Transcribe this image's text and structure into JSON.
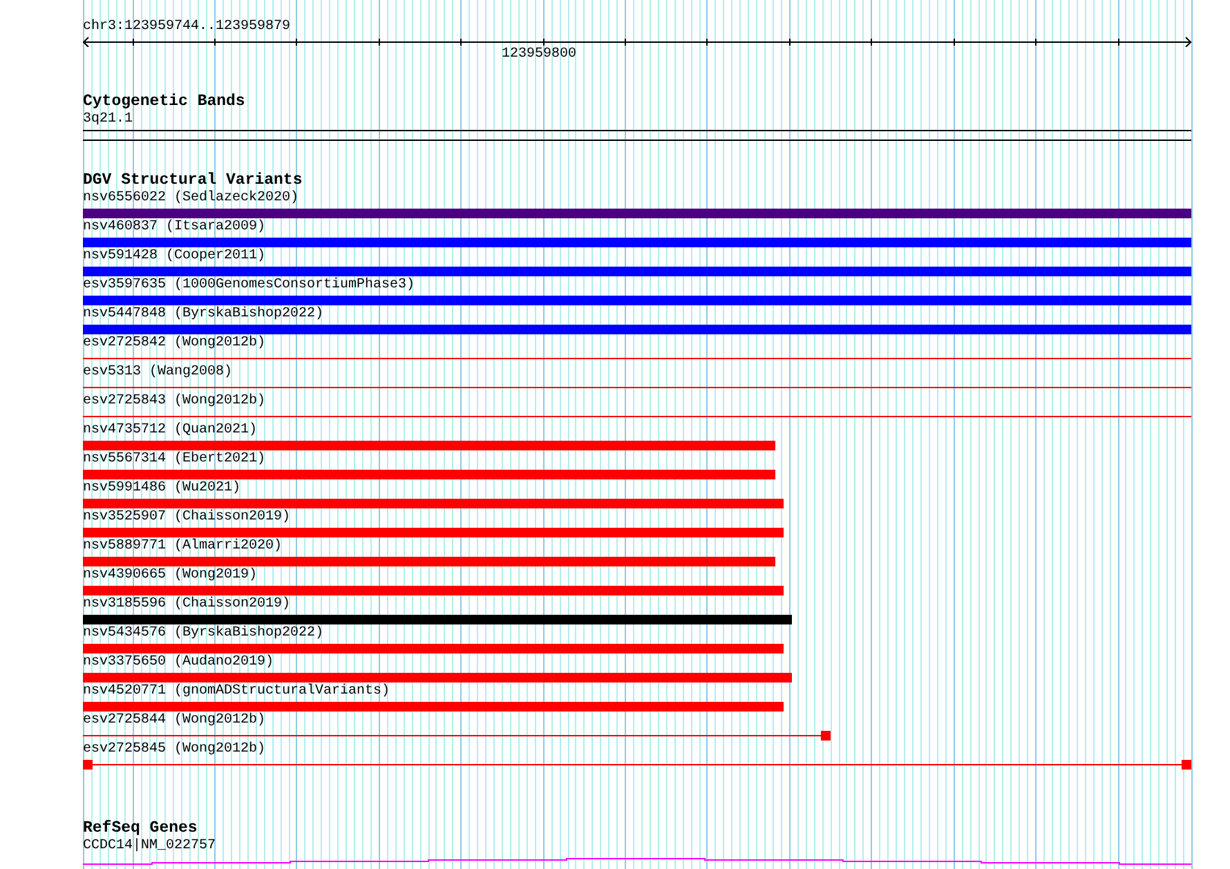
{
  "ruler": {
    "location": "chr3:123959744..123959879",
    "tick_labels": [
      "123959800"
    ]
  },
  "tracks": [
    {
      "title": "Cytogenetic Bands",
      "kind": "bands",
      "features": [
        {
          "label": "3q21.1"
        }
      ]
    },
    {
      "title": "DGV Structural Variants",
      "kind": "variants",
      "features": [
        {
          "label": "nsv6556022 (Sedlazeck2020)",
          "kind": "thick",
          "color": "#4b0082",
          "level": 1
        },
        {
          "label": "nsv460837 (Itsara2009)",
          "kind": "thick",
          "color": "#0000ff",
          "level": 1
        },
        {
          "label": "nsv591428 (Cooper2011)",
          "kind": "thick",
          "color": "#0000ff",
          "level": 1
        },
        {
          "label": "esv3597635 (1000GenomesConsortiumPhase3)",
          "kind": "thick",
          "color": "#0000ff",
          "level": 1
        },
        {
          "label": "nsv5447848 (ByrskaBishop2022)",
          "kind": "thick",
          "color": "#0000ff",
          "level": 1
        },
        {
          "label": "esv2725842 (Wong2012b)",
          "kind": "thin",
          "color": "#ff0000",
          "level": 1
        },
        {
          "label": "esv5313 (Wang2008)",
          "kind": "thin",
          "color": "#ff0000",
          "level": 1
        },
        {
          "label": "esv2725843 (Wong2012b)",
          "kind": "thin",
          "color": "#ff0000",
          "level": 1
        },
        {
          "label": "nsv4735712 (Quan2021)",
          "kind": "thick",
          "color": "#ff0000",
          "level": 0.625
        },
        {
          "label": "nsv5567314 (Ebert2021)",
          "kind": "thick",
          "color": "#ff0000",
          "level": 0.625
        },
        {
          "label": "nsv5991486 (Wu2021)",
          "kind": "thick",
          "color": "#ff0000",
          "level": 0.632
        },
        {
          "label": "nsv3525907 (Chaisson2019)",
          "kind": "thick",
          "color": "#ff0000",
          "level": 0.632
        },
        {
          "label": "nsv5889771 (Almarri2020)",
          "kind": "thick",
          "color": "#ff0000",
          "level": 0.625
        },
        {
          "label": "nsv4390665 (Wong2019)",
          "kind": "thick",
          "color": "#ff0000",
          "level": 0.632
        },
        {
          "label": "nsv3185596 (Chaisson2019)",
          "kind": "thick",
          "color": "#000000",
          "level": 0.64
        },
        {
          "label": "nsv5434576 (ByrskaBishop2022)",
          "kind": "thick",
          "color": "#ff0000",
          "level": 0.632
        },
        {
          "label": "nsv3375650 (Audano2019)",
          "kind": "thick",
          "color": "#ff0000",
          "level": 0.64
        },
        {
          "label": "nsv4520771 (gnomADStructuralVariants)",
          "kind": "thick",
          "color": "#ff0000",
          "level": 0.632
        },
        {
          "label": "esv2725844 (Wong2012b)",
          "kind": "thin-end-marker",
          "color": "#ff0000",
          "level": 0.675
        },
        {
          "label": "esv2725845 (Wong2012b)",
          "kind": "thin-both-markers",
          "color": "#ff0000",
          "level": 1
        }
      ]
    },
    {
      "title": "RefSeq Genes",
      "kind": "genes",
      "features": [
        {
          "label": "CCDC14|NM_022757"
        }
      ]
    }
  ]
}
